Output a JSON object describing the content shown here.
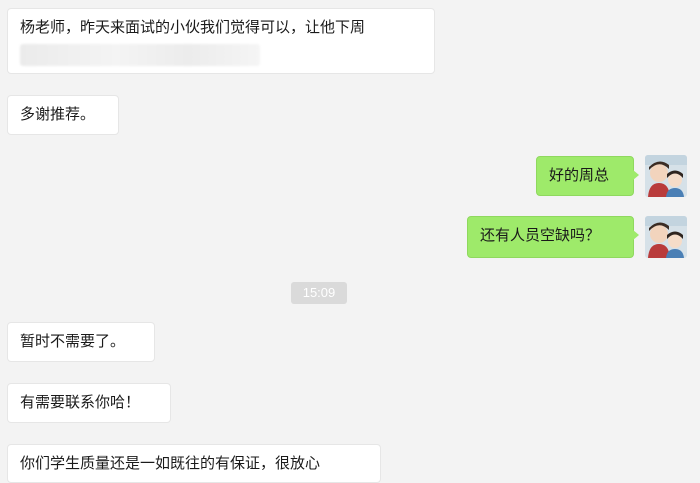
{
  "messages": [
    {
      "side": "left",
      "text": "杨老师，昨天来面试的小伙我们觉得可以，让他下周"
    },
    {
      "side": "left",
      "text": "多谢推荐。"
    },
    {
      "side": "right",
      "text": "好的周总"
    },
    {
      "side": "right",
      "text": "还有人员空缺吗？"
    },
    {
      "side": "left",
      "text": "暂时不需要了。"
    },
    {
      "side": "left",
      "text": "有需要联系你哈！"
    },
    {
      "side": "left",
      "text": "你们学生质量还是一如既往的有保证，很放心"
    }
  ],
  "time_divider": "15:09",
  "colors": {
    "background": "#f3f3f3",
    "incoming_bubble": "#ffffff",
    "outgoing_bubble": "#9eea6a",
    "time_badge": "#dadada"
  },
  "icons": {
    "avatar": "user-photo-avatar-icon"
  }
}
